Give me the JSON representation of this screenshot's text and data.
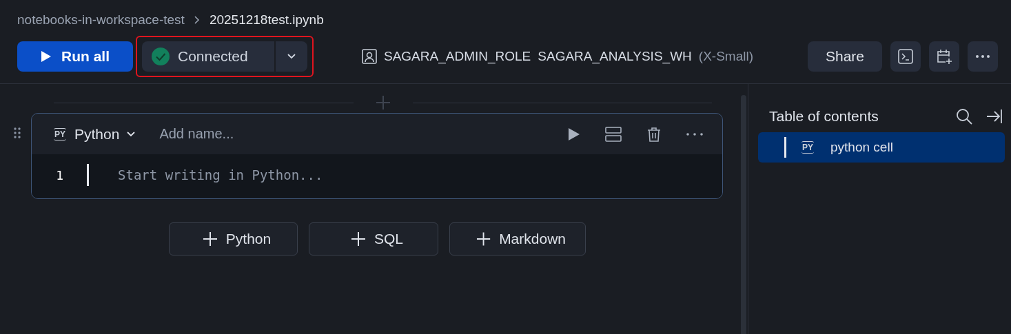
{
  "breadcrumb": {
    "workspace": "notebooks-in-workspace-test",
    "file": "20251218test.ipynb"
  },
  "toolbar": {
    "run_button": "Run all",
    "connection": {
      "label": "Connected",
      "connected": true,
      "highlighted": true
    },
    "role": "SAGARA_ADMIN_ROLE",
    "warehouse": "SAGARA_ANALYSIS_WH",
    "size": "(X-Small)",
    "share_button": "Share"
  },
  "cells": [
    {
      "language_badge": "PY",
      "language": "Python",
      "name_placeholder": "Add name...",
      "lines": [
        {
          "number": "1",
          "placeholder": "Start writing in Python..."
        }
      ]
    }
  ],
  "add_buttons": [
    "Python",
    "SQL",
    "Markdown"
  ],
  "toc": {
    "title": "Table of contents",
    "items": [
      {
        "badge": "PY",
        "label": "python cell",
        "selected": true
      }
    ]
  }
}
